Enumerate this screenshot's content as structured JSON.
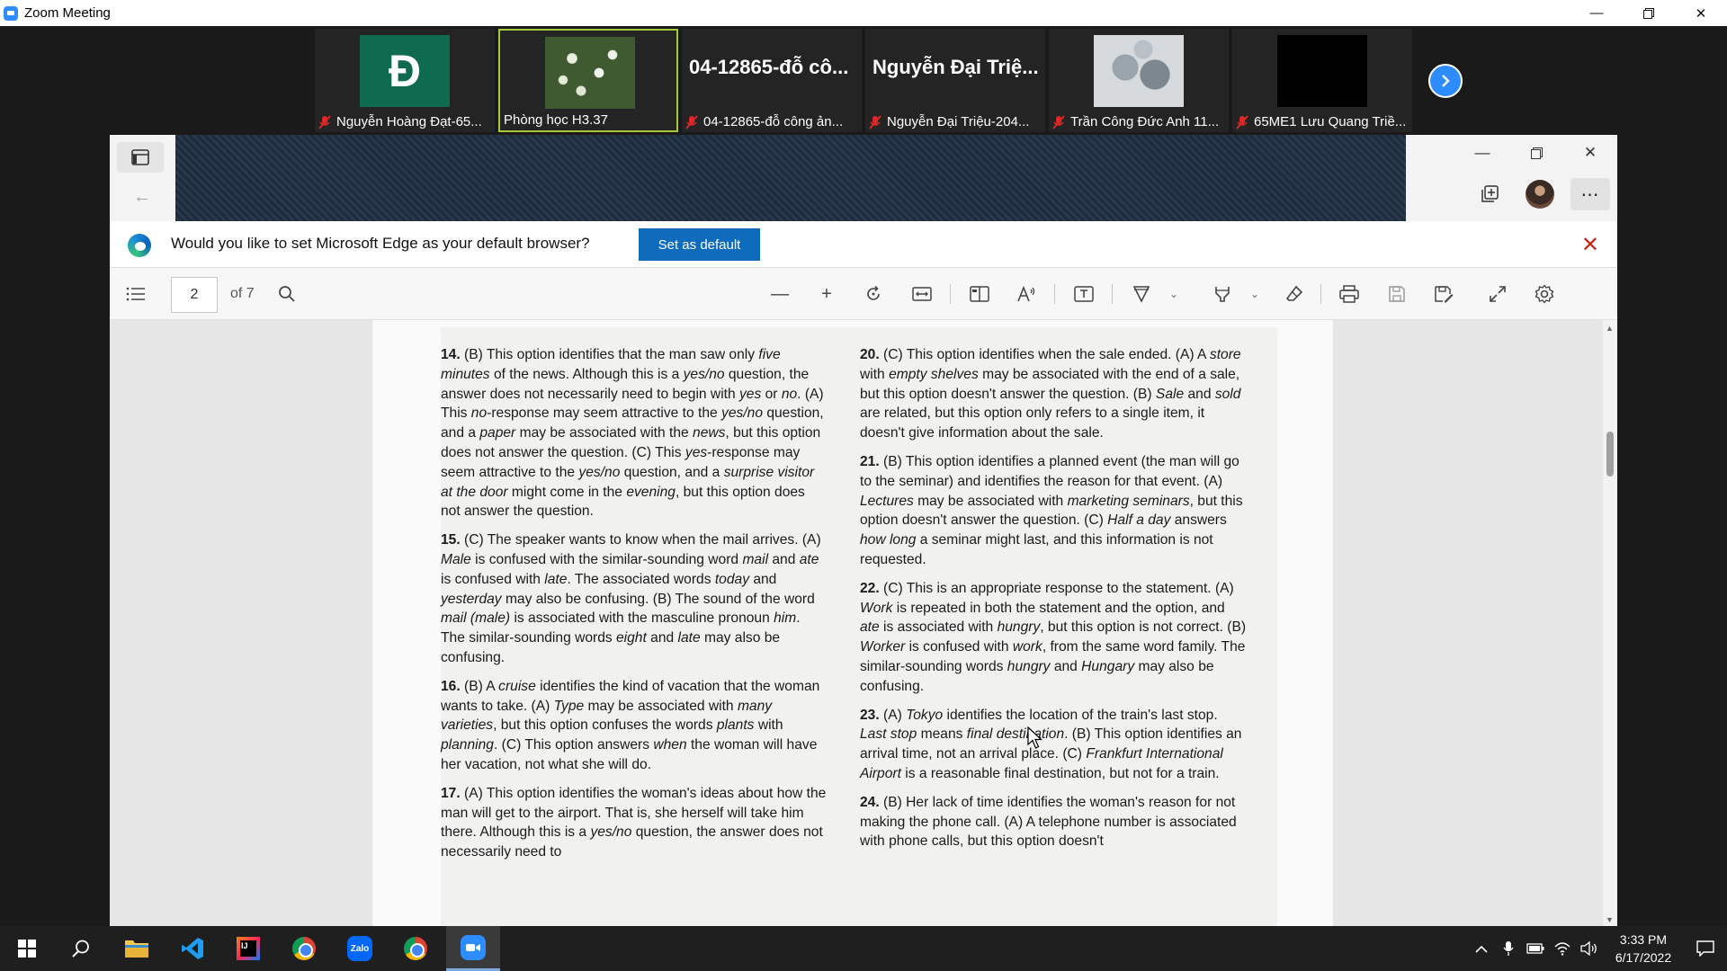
{
  "zoom": {
    "title": "Zoom Meeting",
    "participants": [
      {
        "avatar_letter": "Đ",
        "caption": "Nguyễn Hoàng Đạt-65..."
      },
      {
        "caption": "Phòng học H3.37"
      },
      {
        "big_name": "04-12865-đỗ cô...",
        "caption": "04-12865-đỗ công ản..."
      },
      {
        "big_name": "Nguyễn Đại Triệ...",
        "caption": "Nguyễn Đại Triệu-204..."
      },
      {
        "caption": "Trần Công Đức Anh 11..."
      },
      {
        "caption": "65ME1 Lưu Quang Triề..."
      }
    ]
  },
  "edge": {
    "default_prompt": "Would you like to set Microsoft Edge as your default browser?",
    "set_default_label": "Set as default"
  },
  "pdf": {
    "page_number": "2",
    "page_total": "of 7"
  },
  "doc": {
    "left": [
      [
        {
          "t": "14. ",
          "s": "b"
        },
        {
          "t": "(B) This option identifies that the man saw only "
        },
        {
          "t": "five minutes",
          "s": "i"
        },
        {
          "t": " of the news. Although this is a "
        },
        {
          "t": "yes/no",
          "s": "i"
        },
        {
          "t": " question, the answer does not necessarily need to begin with "
        },
        {
          "t": "yes",
          "s": "i"
        },
        {
          "t": " or "
        },
        {
          "t": "no",
          "s": "i"
        },
        {
          "t": ". (A) This "
        },
        {
          "t": "no",
          "s": "i"
        },
        {
          "t": "-response may seem attractive to the "
        },
        {
          "t": "yes/no",
          "s": "i"
        },
        {
          "t": " question, and a "
        },
        {
          "t": "paper",
          "s": "i"
        },
        {
          "t": " may be associated with the "
        },
        {
          "t": "news",
          "s": "i"
        },
        {
          "t": ", but this option does not answer the question. (C) This "
        },
        {
          "t": "yes",
          "s": "i"
        },
        {
          "t": "-response may seem attractive to the "
        },
        {
          "t": "yes/no",
          "s": "i"
        },
        {
          "t": " question, and a "
        },
        {
          "t": "surprise visitor at the door",
          "s": "i"
        },
        {
          "t": " might come in the "
        },
        {
          "t": "evening",
          "s": "i"
        },
        {
          "t": ", but this option does not answer the question."
        }
      ],
      [
        {
          "t": "15. ",
          "s": "b"
        },
        {
          "t": "(C) The speaker wants to know when the mail arrives. (A) "
        },
        {
          "t": "Male",
          "s": "i"
        },
        {
          "t": " is confused with the similar-sounding word "
        },
        {
          "t": "mail",
          "s": "i"
        },
        {
          "t": " and "
        },
        {
          "t": "ate",
          "s": "i"
        },
        {
          "t": " is confused with "
        },
        {
          "t": "late",
          "s": "i"
        },
        {
          "t": ". The associated words "
        },
        {
          "t": "today",
          "s": "i"
        },
        {
          "t": " and "
        },
        {
          "t": "yesterday",
          "s": "i"
        },
        {
          "t": " may also be confusing. (B) The sound of the word "
        },
        {
          "t": "mail (male)",
          "s": "i"
        },
        {
          "t": " is associated with the masculine pronoun "
        },
        {
          "t": "him",
          "s": "i"
        },
        {
          "t": ". The similar-sounding words "
        },
        {
          "t": "eight",
          "s": "i"
        },
        {
          "t": " and "
        },
        {
          "t": "late",
          "s": "i"
        },
        {
          "t": " may also be confusing."
        }
      ],
      [
        {
          "t": "16. ",
          "s": "b"
        },
        {
          "t": "(B) A "
        },
        {
          "t": "cruise",
          "s": "i"
        },
        {
          "t": " identifies the kind of vacation that the woman wants to take. (A) "
        },
        {
          "t": "Type",
          "s": "i"
        },
        {
          "t": " may be associated with "
        },
        {
          "t": "many varieties",
          "s": "i"
        },
        {
          "t": ", but this option confuses the words "
        },
        {
          "t": "plants",
          "s": "i"
        },
        {
          "t": " with "
        },
        {
          "t": "planning",
          "s": "i"
        },
        {
          "t": ". (C) This option answers "
        },
        {
          "t": "when",
          "s": "i"
        },
        {
          "t": " the woman will have her vacation, not what she will do."
        }
      ],
      [
        {
          "t": "17. ",
          "s": "b"
        },
        {
          "t": "(A) This option identifies the woman's ideas about how the man will get to the airport. That is, she herself will take him there. Although this is a "
        },
        {
          "t": "yes/no",
          "s": "i"
        },
        {
          "t": " question, the answer does not necessarily need to"
        }
      ]
    ],
    "right": [
      [
        {
          "t": "20. ",
          "s": "b"
        },
        {
          "t": "(C) This option identifies when the sale ended. (A) A "
        },
        {
          "t": "store",
          "s": "i"
        },
        {
          "t": " with "
        },
        {
          "t": "empty shelves",
          "s": "i"
        },
        {
          "t": " may be associated with the end of a sale, but this option doesn't answer the question. (B) "
        },
        {
          "t": "Sale",
          "s": "i"
        },
        {
          "t": " and "
        },
        {
          "t": "sold",
          "s": "i"
        },
        {
          "t": " are related, but this option only refers to a single item, it doesn't give information about the sale."
        }
      ],
      [
        {
          "t": "21. ",
          "s": "b"
        },
        {
          "t": "(B) This option identifies a planned event (the man will go to the seminar) and identifies the reason for that event. (A) "
        },
        {
          "t": "Lectures",
          "s": "i"
        },
        {
          "t": " may be associated with "
        },
        {
          "t": "marketing seminars",
          "s": "i"
        },
        {
          "t": ", but this option doesn't answer the question. (C) "
        },
        {
          "t": "Half a day",
          "s": "i"
        },
        {
          "t": " answers "
        },
        {
          "t": "how long",
          "s": "i"
        },
        {
          "t": " a seminar might last, and this information is not requested."
        }
      ],
      [
        {
          "t": "22. ",
          "s": "b"
        },
        {
          "t": "(C) This is an appropriate response to the statement. (A) "
        },
        {
          "t": "Work",
          "s": "i"
        },
        {
          "t": " is repeated in both the statement and the option, and "
        },
        {
          "t": "ate",
          "s": "i"
        },
        {
          "t": " is associated with "
        },
        {
          "t": "hungry",
          "s": "i"
        },
        {
          "t": ", but this option is not correct. (B) "
        },
        {
          "t": "Worker",
          "s": "i"
        },
        {
          "t": " is confused with "
        },
        {
          "t": "work",
          "s": "i"
        },
        {
          "t": ", from the same word family. The similar-sounding words "
        },
        {
          "t": "hungry",
          "s": "i"
        },
        {
          "t": " and "
        },
        {
          "t": "Hungary",
          "s": "i"
        },
        {
          "t": " may also be confusing."
        }
      ],
      [
        {
          "t": "23. ",
          "s": "b"
        },
        {
          "t": "(A) "
        },
        {
          "t": "Tokyo",
          "s": "i"
        },
        {
          "t": " identifies the location of the train's last stop. "
        },
        {
          "t": "Last stop",
          "s": "i"
        },
        {
          "t": " means "
        },
        {
          "t": "final destination",
          "s": "i"
        },
        {
          "t": ". (B) This option identifies an arrival time, not an arrival place. (C) "
        },
        {
          "t": "Frankfurt International Airport",
          "s": "i"
        },
        {
          "t": " is a reasonable final destination, but not for a train."
        }
      ],
      [
        {
          "t": "24. ",
          "s": "b"
        },
        {
          "t": "(B) Her lack of time identifies the woman's reason for not making the phone call. (A) A telephone number is associated with phone calls, but this option doesn't"
        }
      ]
    ]
  },
  "taskbar": {
    "time": "3:33 PM",
    "date": "6/17/2022",
    "zalo_label": "Zalo"
  }
}
